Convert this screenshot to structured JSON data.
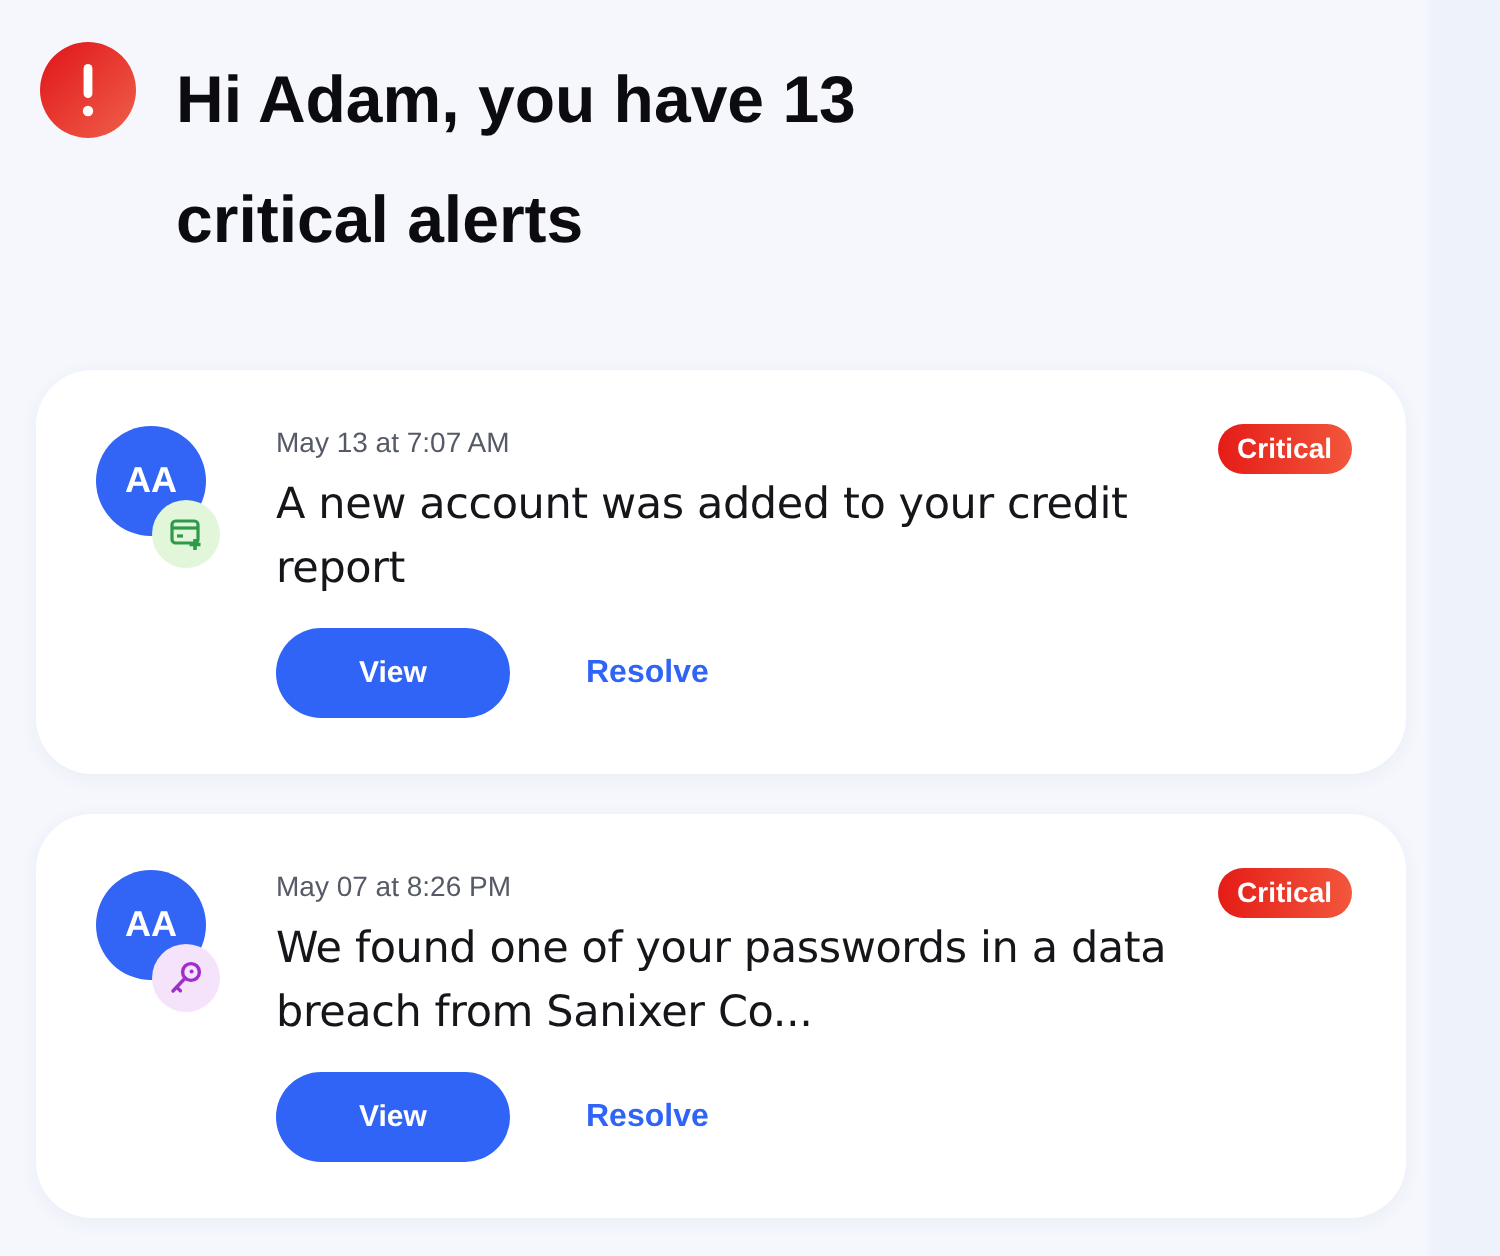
{
  "header": {
    "title": "Hi Adam, you have 13 critical alerts"
  },
  "alerts": [
    {
      "kind": "new-account",
      "avatar": "AA",
      "timestamp": "May 13 at 7:07 AM",
      "message": "A new account was added to your credit report",
      "severity": "Critical",
      "actions": {
        "primary": "View",
        "secondary": "Resolve"
      }
    },
    {
      "kind": "password",
      "avatar": "AA",
      "timestamp": "May 07 at 8:26 PM",
      "message": "We found one of your passwords in a data breach from Sanixer Co...",
      "severity": "Critical",
      "actions": {
        "primary": "View",
        "secondary": "Resolve"
      }
    }
  ]
}
